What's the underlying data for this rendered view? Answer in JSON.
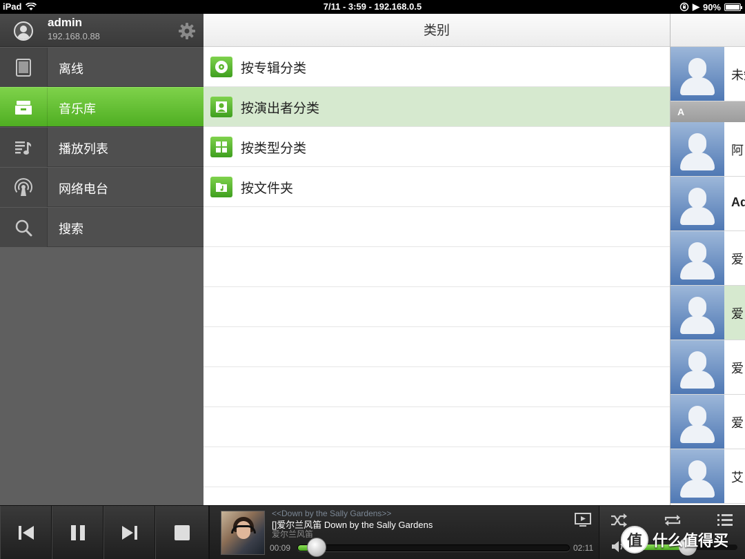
{
  "status_bar": {
    "device": "iPad",
    "center": "7/11 - 3:59 - 192.168.0.5",
    "battery": "90%",
    "battery_level": 0.9
  },
  "sidebar": {
    "user": {
      "name": "admin",
      "ip": "192.168.0.88"
    },
    "items": [
      {
        "label": "离线",
        "icon": "tablet-icon",
        "active": false
      },
      {
        "label": "音乐库",
        "icon": "library-drawer-icon",
        "active": true
      },
      {
        "label": "播放列表",
        "icon": "playlist-icon",
        "active": false
      },
      {
        "label": "网络电台",
        "icon": "radio-icon",
        "active": false
      },
      {
        "label": "搜索",
        "icon": "search-icon",
        "active": false
      }
    ]
  },
  "category_panel": {
    "title": "类别",
    "items": [
      {
        "label": "按专辑分类",
        "icon": "album-disc-icon",
        "selected": false
      },
      {
        "label": "按演出者分类",
        "icon": "artist-person-icon",
        "selected": true
      },
      {
        "label": "按类型分类",
        "icon": "genre-grid-icon",
        "selected": false
      },
      {
        "label": "按文件夹",
        "icon": "music-folder-icon",
        "selected": false
      }
    ]
  },
  "artist_panel": {
    "section_header": "A",
    "rows": [
      {
        "name": "未知",
        "selected": false,
        "bold": false
      },
      {
        "name": "阿",
        "selected": false,
        "bold": false
      },
      {
        "name": "Ad",
        "selected": false,
        "bold": true
      },
      {
        "name": "爱",
        "selected": false,
        "bold": false
      },
      {
        "name": "爱",
        "selected": true,
        "bold": false
      },
      {
        "name": "爱",
        "selected": false,
        "bold": false
      },
      {
        "name": "爱",
        "selected": false,
        "bold": false
      },
      {
        "name": "艾",
        "selected": false,
        "bold": false
      }
    ]
  },
  "player": {
    "album_line": "<<Down by the Sally Gardens>>",
    "track_line": "[]爱尔兰风笛 Down by the Sally Gardens",
    "artist_line": "爱尔兰风笛",
    "elapsed": "00:09",
    "duration": "02:11",
    "progress": 0.07,
    "volume": 0.55,
    "accent": "#5cbf2a"
  },
  "watermark": {
    "badge": "值",
    "text": "什么值得买"
  }
}
